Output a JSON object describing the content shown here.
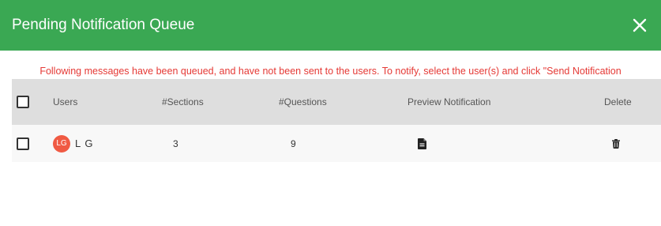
{
  "dialog": {
    "title": "Pending Notification Queue",
    "notice": "Following messages have been queued, and have not been sent to the users. To notify, select the user(s) and click \"Send Notification"
  },
  "table": {
    "columns": {
      "users": "Users",
      "sections": "#Sections",
      "questions": "#Questions",
      "preview": "Preview Notification",
      "delete": "Delete"
    },
    "rows": [
      {
        "avatar_initials": "LG",
        "user": "L G",
        "sections": "3",
        "questions": "9",
        "preview_icon": "document-icon",
        "delete_icon": "trash-icon"
      }
    ]
  },
  "colors": {
    "header_bg": "#3aa853",
    "notice_text": "#e53935",
    "avatar_bg": "#f05a43"
  }
}
